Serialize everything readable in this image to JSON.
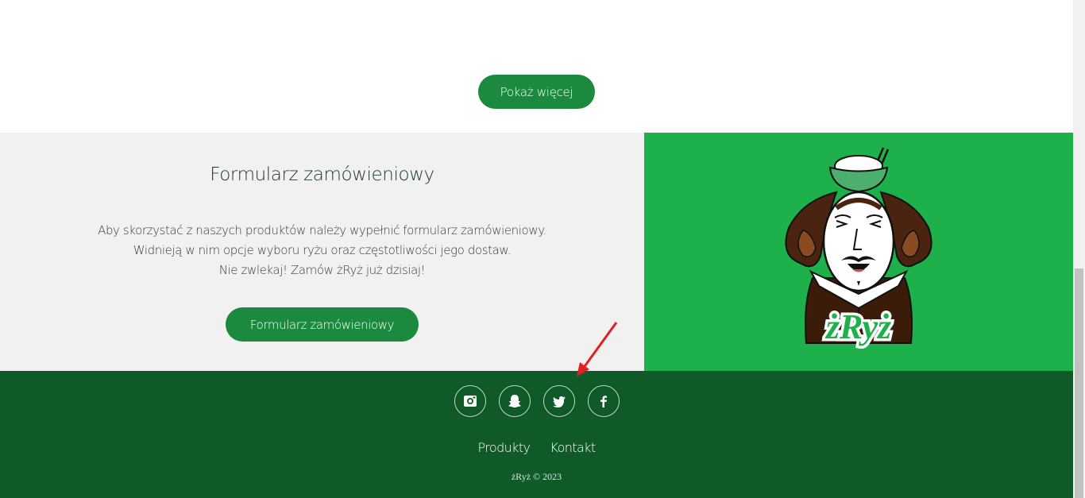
{
  "more_section": {
    "button_label": "Pokaż więcej"
  },
  "order_section": {
    "title": "Formularz zamówieniowy",
    "description_lines": [
      "Aby skorzystać z naszych produktów należy wypełnić formularz zamówieniowy.",
      "Widnieją w nim opcje wyboru ryżu oraz częstotliwości jego dostaw.",
      "Nie zwlekaj! Zamów żRyż już dzisiaj!"
    ],
    "button_label": "Formularz zamówieniowy"
  },
  "logo": {
    "brand_text": "żRyż"
  },
  "footer": {
    "social": [
      {
        "icon": "instagram-icon"
      },
      {
        "icon": "snapchat-icon"
      },
      {
        "icon": "twitter-icon"
      },
      {
        "icon": "facebook-icon"
      }
    ],
    "links": [
      "Produkty",
      "Kontakt"
    ],
    "copyright": "żRyż © 2023"
  },
  "colors": {
    "primary_green": "#1b8a3e",
    "logo_panel_green": "#1db04b",
    "footer_green": "#105a29",
    "section_gray": "#f1f1f1",
    "annotation_red": "#e32020"
  }
}
